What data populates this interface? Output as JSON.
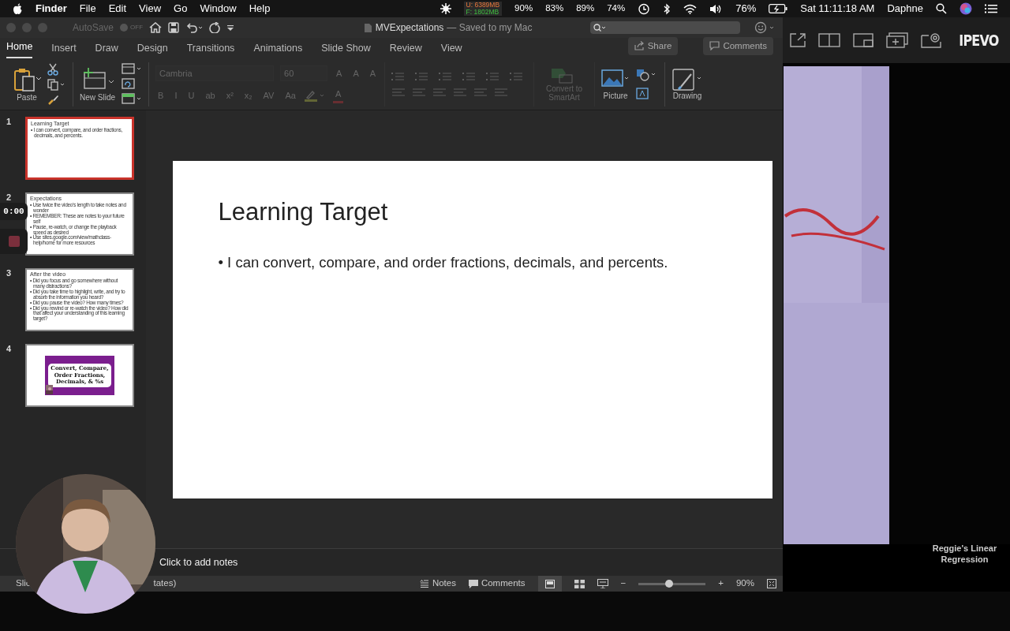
{
  "menubar": {
    "app": "Finder",
    "menus": [
      "File",
      "Edit",
      "View",
      "Go",
      "Window",
      "Help"
    ],
    "memory_used": "U: 6389MB",
    "memory_free": "F: 1802MB",
    "stats": [
      "90%",
      "83%",
      "89%",
      "74%"
    ],
    "battery": "76%",
    "clock": "Sat 11:11:18 AM",
    "user": "Daphne"
  },
  "window": {
    "autosave": "AutoSave",
    "autosave_state": "OFF",
    "title": "MVExpectations",
    "subtitle": "— Saved to my Mac"
  },
  "tabs": [
    {
      "label": "Home",
      "selected": true
    },
    {
      "label": "Insert",
      "selected": false
    },
    {
      "label": "Draw",
      "selected": false
    },
    {
      "label": "Design",
      "selected": false
    },
    {
      "label": "Transitions",
      "selected": false
    },
    {
      "label": "Animations",
      "selected": false
    },
    {
      "label": "Slide Show",
      "selected": false
    },
    {
      "label": "Review",
      "selected": false
    },
    {
      "label": "View",
      "selected": false
    }
  ],
  "share": "Share",
  "comments": "Comments",
  "ribbon": {
    "paste": "Paste",
    "new_slide": "New Slide",
    "font": "Cambria",
    "size": "60",
    "font_disabled": true,
    "size_buttons": [
      "A",
      "A"
    ],
    "clear_format": "A",
    "format_buttons": [
      "B",
      "I",
      "U",
      "ab",
      "x²",
      "x₂",
      "AV",
      "Aa"
    ],
    "font_color": "A",
    "convert": "Convert to SmartArt",
    "picture": "Picture",
    "drawing": "Drawing"
  },
  "slides": [
    {
      "number": "1",
      "selected": true,
      "kind": "text",
      "title": "Learning Target",
      "bullets": [
        "• I can convert, compare, and order fractions, decimals, and percents."
      ]
    },
    {
      "number": "2",
      "selected": false,
      "kind": "text",
      "title": "Expectations",
      "bullets": [
        "• Use twice the video's length to take notes and wonder",
        "• REMEMBER: These are notes to your future self",
        "• Pause, re-watch, or change the playback speed as desired",
        "• Use sites.google.com/view/mathclass-help/home for more resources"
      ]
    },
    {
      "number": "3",
      "selected": false,
      "kind": "text",
      "title": "After the video",
      "bullets": [
        "• Did you focus and go somewhere without many distractions?",
        "• Did you take time to highlight, write, and try to absorb the information you heard?",
        "• Did you pause the video? How many times?",
        "• Did you rewind or re-watch the video? How did that affect your understanding of this learning target?"
      ]
    },
    {
      "number": "4",
      "selected": false,
      "kind": "banner",
      "banner": "Convert, Compare, Order Fractions, Decimals, & %s"
    }
  ],
  "recording": {
    "time": "0:00"
  },
  "slide": {
    "title": "Learning Target",
    "bullets": [
      "• I can convert, compare, and order fractions, decimals, and percents."
    ]
  },
  "notes_placeholder": "Click to add notes",
  "status": {
    "left": "Slic",
    "right": "tates)",
    "notes": "Notes",
    "comments": "Comments",
    "zoom_out": "−",
    "zoom_in": "+",
    "zoom": "90%",
    "zoom_slider": {
      "level": 0.45
    }
  },
  "ipevo": {
    "brand": "IPEVO",
    "caption": "Reggie's Linear Regression"
  }
}
